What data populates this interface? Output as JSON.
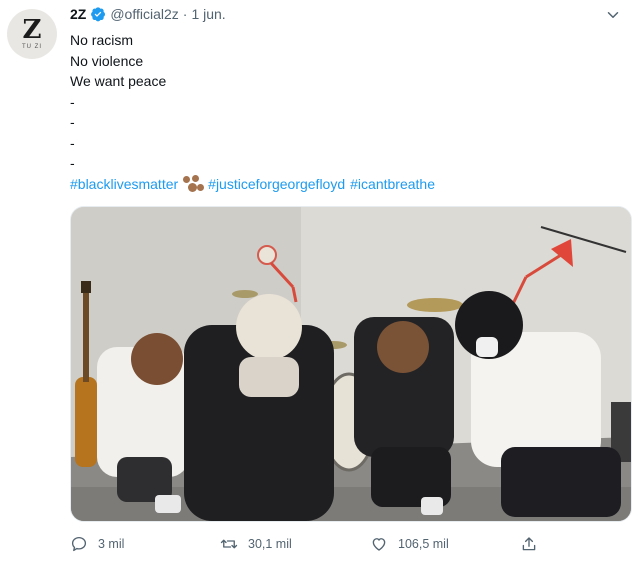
{
  "author": {
    "display_name": "2Z",
    "handle": "@official2z",
    "date": "1 jun.",
    "avatar_logo": "Z",
    "avatar_sub": "TU ZI",
    "verified": true,
    "verified_color": "#1d9bf0"
  },
  "tweet": {
    "lines": [
      "No racism",
      "No violence",
      "We want peace",
      "-",
      "-",
      "-",
      "-"
    ],
    "hashtags": [
      "#blacklivesmatter",
      "#justiceforgeorgefloyd",
      "#icantbreathe"
    ],
    "hashtag_color": "#1d9bf0",
    "emoji_icon": "paw-prints-icon",
    "media_description_icon": "photo-icon"
  },
  "actions": {
    "reply_count": "3 mil",
    "retweet_count": "30,1 mil",
    "like_count": "106,5 mil",
    "icons": [
      "reply-icon",
      "retweet-icon",
      "like-icon",
      "share-icon"
    ]
  },
  "colors": {
    "muted_text": "#536471",
    "primary_text": "#0f1419"
  }
}
